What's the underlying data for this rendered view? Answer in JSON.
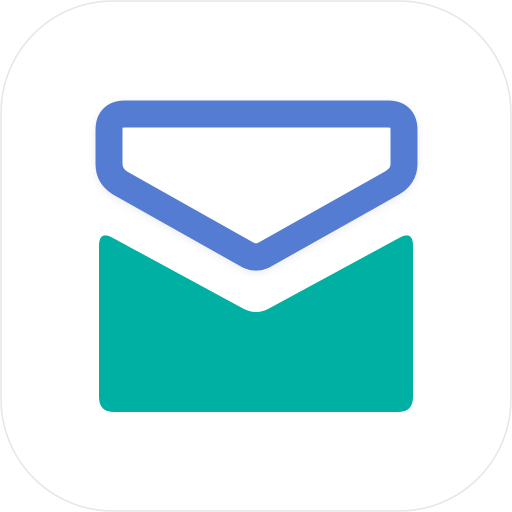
{
  "icon": {
    "name": "mail-envelope-icon",
    "colors": {
      "tile_background": "#ffffff",
      "tile_border": "#e6e6ea",
      "flap_stroke": "#527bd2",
      "envelope_body": "#00b1a3"
    }
  }
}
